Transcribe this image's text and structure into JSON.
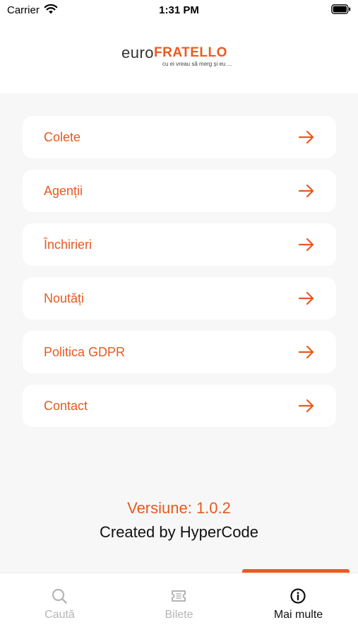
{
  "status_bar": {
    "carrier": "Carrier",
    "time": "1:31 PM"
  },
  "brand": {
    "euro": "euro",
    "fratello": "FRATELLO",
    "tagline": "cu ei vreau să merg și eu ..."
  },
  "menu": {
    "items": [
      {
        "label": "Colete"
      },
      {
        "label": "Agenții"
      },
      {
        "label": "Închirieri"
      },
      {
        "label": "Noutăți"
      },
      {
        "label": "Politica GDPR"
      },
      {
        "label": "Contact"
      }
    ]
  },
  "footer": {
    "version": "Versiune: 1.0.2",
    "created_by": "Created by HyperCode"
  },
  "tabs": [
    {
      "label": "Caută",
      "icon": "search-icon",
      "active": false
    },
    {
      "label": "Bilete",
      "icon": "ticket-icon",
      "active": false
    },
    {
      "label": "Mai multe",
      "icon": "info-icon",
      "active": true
    }
  ],
  "colors": {
    "accent": "#e65a1f",
    "background": "#f7f7f7",
    "card": "#ffffff",
    "inactive_tab": "#b5b5b5"
  }
}
